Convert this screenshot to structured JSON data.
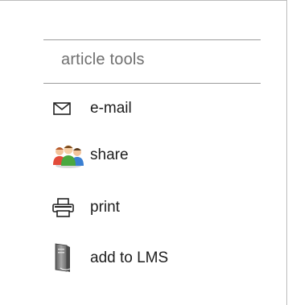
{
  "panel": {
    "heading": "article tools",
    "tools": [
      {
        "label": "e-mail",
        "icon": "envelope-icon"
      },
      {
        "label": "share",
        "icon": "people-icon"
      },
      {
        "label": "print",
        "icon": "printer-icon"
      },
      {
        "label": "add to LMS",
        "icon": "server-icon"
      }
    ]
  },
  "colors": {
    "heading": "#6f6f6f",
    "text": "#1d1d1d",
    "rule": "#9c9c9c"
  }
}
